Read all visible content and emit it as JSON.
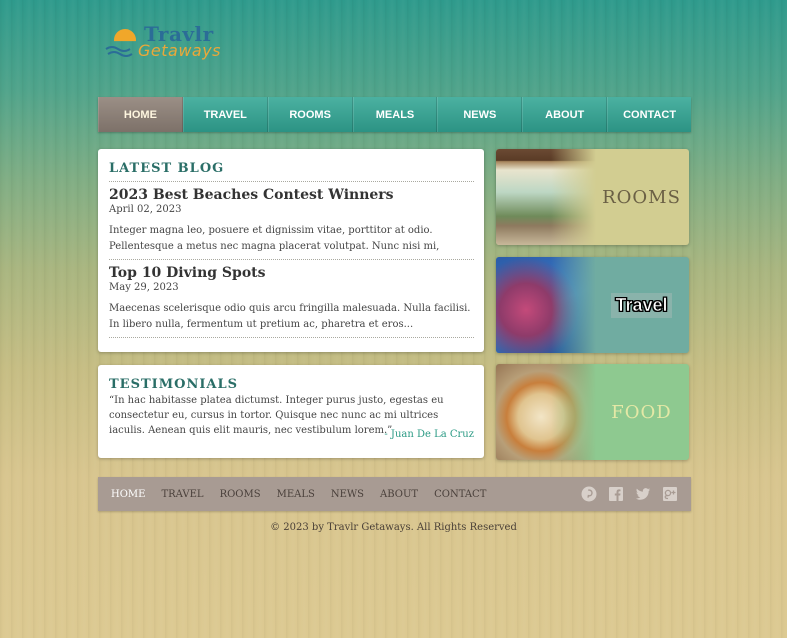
{
  "logo": {
    "line1": "Travlr",
    "line2": "Getaways"
  },
  "nav": {
    "items": [
      {
        "label": "HOME"
      },
      {
        "label": "TRAVEL"
      },
      {
        "label": "ROOMS"
      },
      {
        "label": "MEALS"
      },
      {
        "label": "NEWS"
      },
      {
        "label": "ABOUT"
      },
      {
        "label": "CONTACT"
      }
    ],
    "active": "HOME"
  },
  "blog": {
    "heading": "LATEST BLOG",
    "posts": [
      {
        "title": "2023 Best Beaches Contest Winners",
        "date": "April 02, 2023",
        "body": "Integer magna leo, posuere et dignissim vitae, porttitor at odio. Pellentesque a metus nec magna placerat volutpat. Nunc nisi mi, elementum sit amet..."
      },
      {
        "title": "Top 10 Diving Spots",
        "date": "May 29, 2023",
        "body": "Maecenas scelerisque odio quis arcu fringilla malesuada. Nulla facilisi. In libero nulla, fermentum ut pretium ac, pharetra et eros..."
      }
    ]
  },
  "testimonials": {
    "heading": "TESTIMONIALS",
    "quote": "“In hac habitasse platea dictumst. Integer purus justo, egestas eu consectetur eu, cursus in tortor. Quisque nec nunc ac mi ultrices iaculis. Aenean quis elit mauris, nec vestibulum lorem.”",
    "author": "- Juan De La Cruz"
  },
  "tiles": [
    {
      "label": "ROOMS",
      "color": "#d2cd91"
    },
    {
      "label": "Travel",
      "color": "#70aca1"
    },
    {
      "label": "FOOD",
      "color": "#8ec990"
    }
  ],
  "footer": {
    "items": [
      {
        "label": "HOME"
      },
      {
        "label": "TRAVEL"
      },
      {
        "label": "ROOMS"
      },
      {
        "label": "MEALS"
      },
      {
        "label": "NEWS"
      },
      {
        "label": "ABOUT"
      },
      {
        "label": "CONTACT"
      }
    ],
    "social": [
      "pinterest-icon",
      "facebook-icon",
      "twitter-icon",
      "google-plus-icon"
    ],
    "copyright": "© 2023 by Travlr Getaways. All Rights Reserved"
  },
  "colors": {
    "accent_teal": "#2c9384",
    "nav_active": "#7d7169",
    "footer_bar": "#a89b93",
    "author_link": "#2a9a84"
  }
}
